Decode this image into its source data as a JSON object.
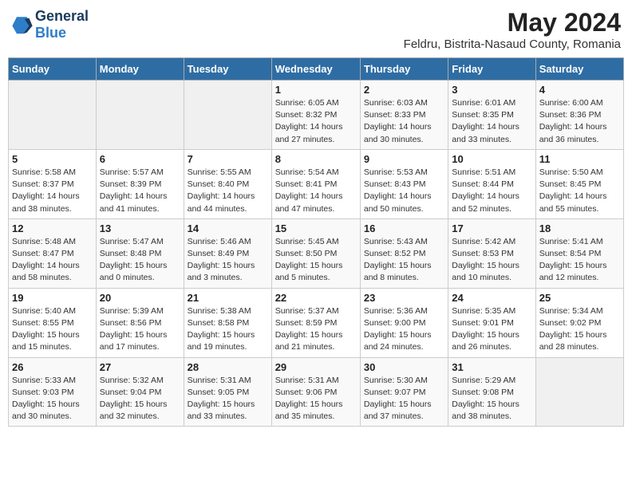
{
  "logo": {
    "line1": "General",
    "line2": "Blue"
  },
  "title": {
    "month_year": "May 2024",
    "location": "Feldru, Bistrita-Nasaud County, Romania"
  },
  "weekdays": [
    "Sunday",
    "Monday",
    "Tuesday",
    "Wednesday",
    "Thursday",
    "Friday",
    "Saturday"
  ],
  "weeks": [
    [
      {
        "day": "",
        "sunrise": "",
        "sunset": "",
        "daylight": ""
      },
      {
        "day": "",
        "sunrise": "",
        "sunset": "",
        "daylight": ""
      },
      {
        "day": "",
        "sunrise": "",
        "sunset": "",
        "daylight": ""
      },
      {
        "day": "1",
        "sunrise": "Sunrise: 6:05 AM",
        "sunset": "Sunset: 8:32 PM",
        "daylight": "Daylight: 14 hours and 27 minutes."
      },
      {
        "day": "2",
        "sunrise": "Sunrise: 6:03 AM",
        "sunset": "Sunset: 8:33 PM",
        "daylight": "Daylight: 14 hours and 30 minutes."
      },
      {
        "day": "3",
        "sunrise": "Sunrise: 6:01 AM",
        "sunset": "Sunset: 8:35 PM",
        "daylight": "Daylight: 14 hours and 33 minutes."
      },
      {
        "day": "4",
        "sunrise": "Sunrise: 6:00 AM",
        "sunset": "Sunset: 8:36 PM",
        "daylight": "Daylight: 14 hours and 36 minutes."
      }
    ],
    [
      {
        "day": "5",
        "sunrise": "Sunrise: 5:58 AM",
        "sunset": "Sunset: 8:37 PM",
        "daylight": "Daylight: 14 hours and 38 minutes."
      },
      {
        "day": "6",
        "sunrise": "Sunrise: 5:57 AM",
        "sunset": "Sunset: 8:39 PM",
        "daylight": "Daylight: 14 hours and 41 minutes."
      },
      {
        "day": "7",
        "sunrise": "Sunrise: 5:55 AM",
        "sunset": "Sunset: 8:40 PM",
        "daylight": "Daylight: 14 hours and 44 minutes."
      },
      {
        "day": "8",
        "sunrise": "Sunrise: 5:54 AM",
        "sunset": "Sunset: 8:41 PM",
        "daylight": "Daylight: 14 hours and 47 minutes."
      },
      {
        "day": "9",
        "sunrise": "Sunrise: 5:53 AM",
        "sunset": "Sunset: 8:43 PM",
        "daylight": "Daylight: 14 hours and 50 minutes."
      },
      {
        "day": "10",
        "sunrise": "Sunrise: 5:51 AM",
        "sunset": "Sunset: 8:44 PM",
        "daylight": "Daylight: 14 hours and 52 minutes."
      },
      {
        "day": "11",
        "sunrise": "Sunrise: 5:50 AM",
        "sunset": "Sunset: 8:45 PM",
        "daylight": "Daylight: 14 hours and 55 minutes."
      }
    ],
    [
      {
        "day": "12",
        "sunrise": "Sunrise: 5:48 AM",
        "sunset": "Sunset: 8:47 PM",
        "daylight": "Daylight: 14 hours and 58 minutes."
      },
      {
        "day": "13",
        "sunrise": "Sunrise: 5:47 AM",
        "sunset": "Sunset: 8:48 PM",
        "daylight": "Daylight: 15 hours and 0 minutes."
      },
      {
        "day": "14",
        "sunrise": "Sunrise: 5:46 AM",
        "sunset": "Sunset: 8:49 PM",
        "daylight": "Daylight: 15 hours and 3 minutes."
      },
      {
        "day": "15",
        "sunrise": "Sunrise: 5:45 AM",
        "sunset": "Sunset: 8:50 PM",
        "daylight": "Daylight: 15 hours and 5 minutes."
      },
      {
        "day": "16",
        "sunrise": "Sunrise: 5:43 AM",
        "sunset": "Sunset: 8:52 PM",
        "daylight": "Daylight: 15 hours and 8 minutes."
      },
      {
        "day": "17",
        "sunrise": "Sunrise: 5:42 AM",
        "sunset": "Sunset: 8:53 PM",
        "daylight": "Daylight: 15 hours and 10 minutes."
      },
      {
        "day": "18",
        "sunrise": "Sunrise: 5:41 AM",
        "sunset": "Sunset: 8:54 PM",
        "daylight": "Daylight: 15 hours and 12 minutes."
      }
    ],
    [
      {
        "day": "19",
        "sunrise": "Sunrise: 5:40 AM",
        "sunset": "Sunset: 8:55 PM",
        "daylight": "Daylight: 15 hours and 15 minutes."
      },
      {
        "day": "20",
        "sunrise": "Sunrise: 5:39 AM",
        "sunset": "Sunset: 8:56 PM",
        "daylight": "Daylight: 15 hours and 17 minutes."
      },
      {
        "day": "21",
        "sunrise": "Sunrise: 5:38 AM",
        "sunset": "Sunset: 8:58 PM",
        "daylight": "Daylight: 15 hours and 19 minutes."
      },
      {
        "day": "22",
        "sunrise": "Sunrise: 5:37 AM",
        "sunset": "Sunset: 8:59 PM",
        "daylight": "Daylight: 15 hours and 21 minutes."
      },
      {
        "day": "23",
        "sunrise": "Sunrise: 5:36 AM",
        "sunset": "Sunset: 9:00 PM",
        "daylight": "Daylight: 15 hours and 24 minutes."
      },
      {
        "day": "24",
        "sunrise": "Sunrise: 5:35 AM",
        "sunset": "Sunset: 9:01 PM",
        "daylight": "Daylight: 15 hours and 26 minutes."
      },
      {
        "day": "25",
        "sunrise": "Sunrise: 5:34 AM",
        "sunset": "Sunset: 9:02 PM",
        "daylight": "Daylight: 15 hours and 28 minutes."
      }
    ],
    [
      {
        "day": "26",
        "sunrise": "Sunrise: 5:33 AM",
        "sunset": "Sunset: 9:03 PM",
        "daylight": "Daylight: 15 hours and 30 minutes."
      },
      {
        "day": "27",
        "sunrise": "Sunrise: 5:32 AM",
        "sunset": "Sunset: 9:04 PM",
        "daylight": "Daylight: 15 hours and 32 minutes."
      },
      {
        "day": "28",
        "sunrise": "Sunrise: 5:31 AM",
        "sunset": "Sunset: 9:05 PM",
        "daylight": "Daylight: 15 hours and 33 minutes."
      },
      {
        "day": "29",
        "sunrise": "Sunrise: 5:31 AM",
        "sunset": "Sunset: 9:06 PM",
        "daylight": "Daylight: 15 hours and 35 minutes."
      },
      {
        "day": "30",
        "sunrise": "Sunrise: 5:30 AM",
        "sunset": "Sunset: 9:07 PM",
        "daylight": "Daylight: 15 hours and 37 minutes."
      },
      {
        "day": "31",
        "sunrise": "Sunrise: 5:29 AM",
        "sunset": "Sunset: 9:08 PM",
        "daylight": "Daylight: 15 hours and 38 minutes."
      },
      {
        "day": "",
        "sunrise": "",
        "sunset": "",
        "daylight": ""
      }
    ]
  ]
}
